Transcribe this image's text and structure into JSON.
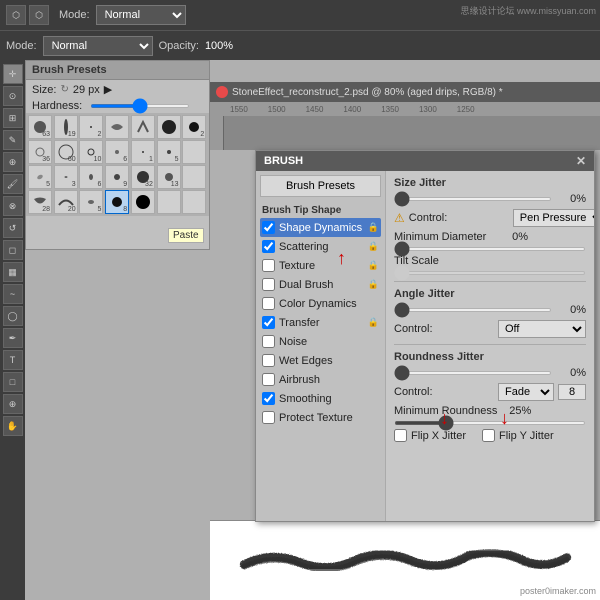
{
  "watermark_top": "思缘设计论坛 www.missyuan.com",
  "watermark_bottom": "poster0imaker.com",
  "top_toolbar": {
    "mode_label": "Mode:",
    "mode_value": "Normal",
    "opacity_label": "Opacity:",
    "opacity_value": "100%"
  },
  "brush_presets_panel": {
    "title": "Brush Presets",
    "size_label": "Size:",
    "size_value": "29 px",
    "hardness_label": "Hardness:",
    "grid": [
      {
        "num": "63"
      },
      {
        "num": "19"
      },
      {
        "num": "2"
      },
      {
        "num": ""
      },
      {
        "num": ""
      },
      {
        "num": ""
      },
      {
        "num": ""
      },
      {
        "num": "36"
      },
      {
        "num": "60"
      },
      {
        "num": "10"
      },
      {
        "num": "6"
      },
      {
        "num": "1"
      },
      {
        "num": "5"
      },
      {
        "num": ""
      },
      {
        "num": "5"
      },
      {
        "num": "3"
      },
      {
        "num": "6"
      },
      {
        "num": "9"
      },
      {
        "num": "32"
      },
      {
        "num": "13"
      },
      {
        "num": ""
      },
      {
        "num": "28"
      },
      {
        "num": "20"
      },
      {
        "num": "5"
      },
      {
        "num": "8"
      },
      {
        "num": ""
      },
      {
        "num": ""
      },
      {
        "num": ""
      }
    ]
  },
  "document": {
    "title": "StoneEffect_reconstruct_2.psd @ 80% (aged drips, RGB/8) *",
    "rulers": [
      "1550",
      "1500",
      "1450",
      "1400",
      "1350",
      "1300",
      "1250"
    ]
  },
  "brush_panel": {
    "title": "BRUSH",
    "close": "✕",
    "brush_presets_btn": "Brush Presets",
    "brush_tip_shape_label": "Brush Tip Shape",
    "size_jitter_label": "Size Jitter",
    "size_jitter_value": "0%",
    "control_label": "Control:",
    "control_value": "Pen Pressure",
    "minimum_diameter_label": "Minimum Diameter",
    "minimum_diameter_value": "0%",
    "tilt_scale_label": "Tilt Scale",
    "angle_jitter_label": "Angle Jitter",
    "angle_jitter_value": "0%",
    "control2_label": "Control:",
    "control2_value": "Off",
    "roundness_jitter_label": "Roundness Jitter",
    "roundness_jitter_value": "0%",
    "control3_label": "Control:",
    "control3_value": "Fade",
    "control3_num": "8",
    "minimum_roundness_label": "Minimum Roundness",
    "minimum_roundness_value": "25%",
    "flip_x_label": "Flip X Jitter",
    "flip_y_label": "Flip Y Jitter",
    "checkboxes": [
      {
        "label": "Shape Dynamics",
        "checked": true,
        "highlighted": true
      },
      {
        "label": "Scattering",
        "checked": true,
        "highlighted": false
      },
      {
        "label": "Texture",
        "checked": false,
        "highlighted": false
      },
      {
        "label": "Dual Brush",
        "checked": false,
        "highlighted": false
      },
      {
        "label": "Color Dynamics",
        "checked": false,
        "highlighted": false
      },
      {
        "label": "Transfer",
        "checked": true,
        "highlighted": false
      },
      {
        "label": "Noise",
        "checked": false,
        "highlighted": false
      },
      {
        "label": "Wet Edges",
        "checked": false,
        "highlighted": false
      },
      {
        "label": "Airbrush",
        "checked": false,
        "highlighted": false
      },
      {
        "label": "Smoothing",
        "checked": true,
        "highlighted": false
      },
      {
        "label": "Protect Texture",
        "checked": false,
        "highlighted": false
      }
    ]
  },
  "paste_tooltip": "Paste",
  "icons": {
    "brush": "🖌",
    "eraser": "◻",
    "move": "✛",
    "lasso": "⊙",
    "crop": "⊞",
    "eyedropper": "✎",
    "heal": "⊕",
    "stamp": "⊗",
    "history": "↺",
    "smudge": "~",
    "dodge": "◯",
    "pen": "✒",
    "text": "T",
    "shape": "□",
    "zoom": "⊕",
    "hand": "✋"
  }
}
